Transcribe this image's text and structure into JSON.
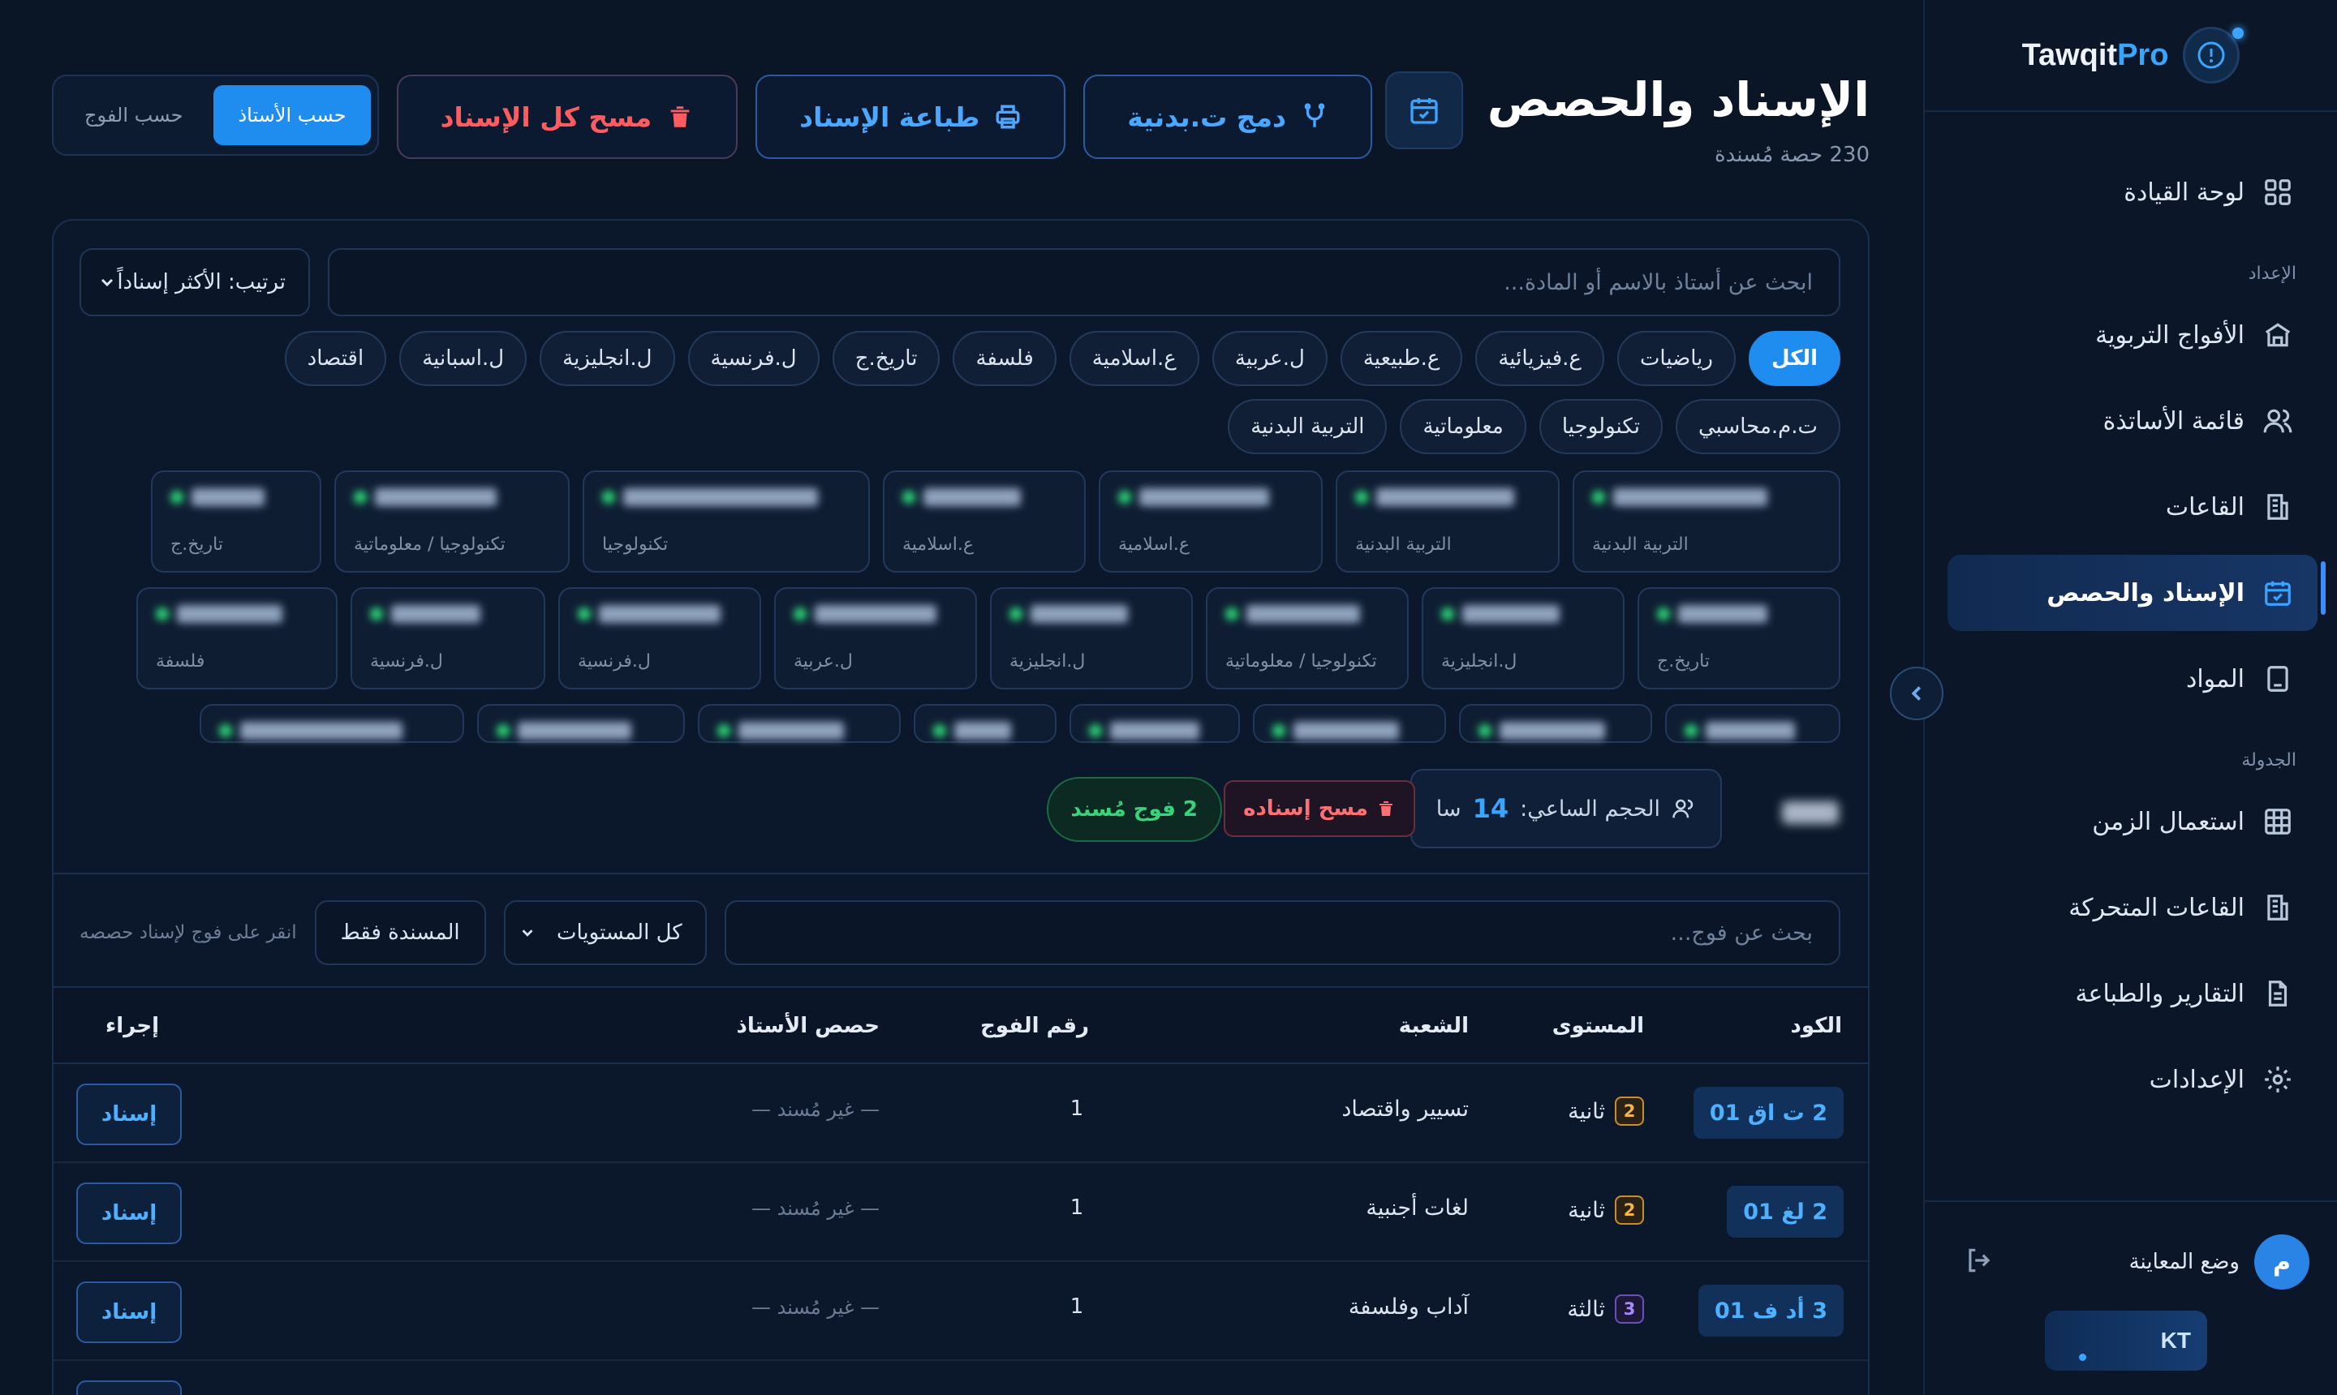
{
  "brand": {
    "name_main": "Tawqit",
    "name_accent": "Pro"
  },
  "nav": {
    "dashboard": "لوحة القيادة",
    "section_setup": "الإعداد",
    "groups": "الأفواج التربوية",
    "teachers": "قائمة الأساتذة",
    "rooms": "القاعات",
    "assignment": "الإسناد والحصص",
    "subjects": "المواد",
    "section_schedule": "الجدولة",
    "timetable": "استعمال الزمن",
    "mobile_rooms": "القاعات المتحركة",
    "reports": "التقارير والطباعة",
    "settings": "الإعدادات"
  },
  "user": {
    "avatar": "م",
    "label": "وضع المعاينة",
    "mini_logo": "KT"
  },
  "header": {
    "title": "الإسناد والحصص",
    "subtitle": "230 حصة مُسندة"
  },
  "actions": {
    "merge": "دمج ت.بدنية",
    "print": "طباعة الإسناد",
    "clear_all": "مسح كل الإسناد",
    "view_by_teacher": "حسب الأستاذ",
    "view_by_group": "حسب الفوج"
  },
  "teacher_search": {
    "placeholder": "ابحث عن أستاذ بالاسم أو المادة...",
    "sort": "ترتيب: الأكثر إسناداً"
  },
  "subject_chips": [
    "الكل",
    "رياضيات",
    "ع.فيزيائية",
    "ع.طبيعية",
    "ل.عربية",
    "ع.اسلامية",
    "فلسفة",
    "تاريخ.ج",
    "ل.فرنسية",
    "ل.انجليزية",
    "ل.اسبانية",
    "اقتصاد",
    "ت.م.محاسبي",
    "تكنولوجيا",
    "معلوماتية",
    "التربية البدنية"
  ],
  "teacher_cards": {
    "row1": [
      "التربية البدنية",
      "التربية البدنية",
      "ع.اسلامية",
      "ع.اسلامية",
      "تكنولوجيا",
      "تكنولوجيا / معلوماتية",
      "تاريخ.ج"
    ],
    "row2": [
      "تاريخ.ج",
      "ل.انجليزية",
      "تكنولوجيا / معلوماتية",
      "ل.انجليزية",
      "ل.عربية",
      "ل.فرنسية",
      "ل.فرنسية",
      "فلسفة"
    ]
  },
  "selected_teacher": {
    "volume_label": "الحجم الساعي:",
    "volume_value": "14",
    "volume_unit": "سا",
    "clear": "مسح إسناده",
    "assigned": "2 فوج مُسند"
  },
  "group_filter": {
    "placeholder": "بحث عن فوج...",
    "levels": "كل المستويات",
    "only_assigned": "المسندة فقط",
    "hint": "انقر على فوج لإسناد حصصه"
  },
  "table": {
    "headers": {
      "code": "الكود",
      "level": "المستوى",
      "branch": "الشعبة",
      "group_no": "رقم الفوج",
      "teacher_hours": "حصص الأستاذ",
      "action": "إجراء"
    },
    "rows": [
      {
        "code": "2 ت اق 01",
        "level_num": "2",
        "level": "ثانية",
        "branch": "تسيير واقتصاد",
        "group_no": "1",
        "teacher_hours": "— غير مُسند —",
        "action": "إسناد"
      },
      {
        "code": "2 لغ 01",
        "level_num": "2",
        "level": "ثانية",
        "branch": "لغات أجنبية",
        "group_no": "1",
        "teacher_hours": "— غير مُسند —",
        "action": "إسناد"
      },
      {
        "code": "3 أد ف 01",
        "level_num": "3",
        "level": "ثالثة",
        "branch": "آداب وفلسفة",
        "group_no": "1",
        "teacher_hours": "— غير مُسند —",
        "action": "إسناد"
      }
    ]
  },
  "colors": {
    "accent": "#1f8cf0",
    "danger": "#ff5c61",
    "success": "#39d37c"
  }
}
